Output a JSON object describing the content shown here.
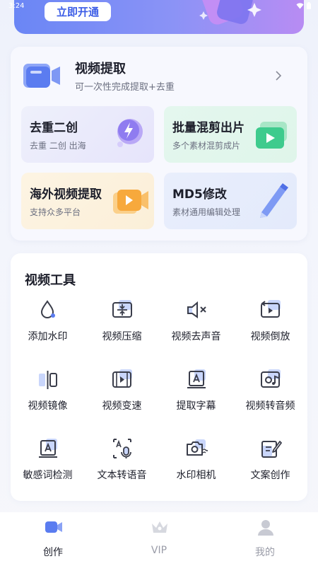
{
  "status": {
    "time": "3:24"
  },
  "banner": {
    "button_label": "立即开通"
  },
  "extract": {
    "title": "视频提取",
    "subtitle": "可一次性完成提取+去重"
  },
  "tiles": [
    {
      "title": "去重二创",
      "subtitle": "去重 二创 出海"
    },
    {
      "title": "批量混剪出片",
      "subtitle": "多个素材混剪成片"
    },
    {
      "title": "海外视频提取",
      "subtitle": "支持众多平台"
    },
    {
      "title": "MD5修改",
      "subtitle": "素材通用编辑处理"
    }
  ],
  "tools": {
    "title": "视频工具",
    "items": [
      {
        "label": "添加水印",
        "icon": "watermark-drop-icon"
      },
      {
        "label": "视频压缩",
        "icon": "compress-icon"
      },
      {
        "label": "视频去声音",
        "icon": "mute-icon"
      },
      {
        "label": "视频倒放",
        "icon": "reverse-icon"
      },
      {
        "label": "视频镜像",
        "icon": "mirror-icon"
      },
      {
        "label": "视频变速",
        "icon": "speed-icon"
      },
      {
        "label": "提取字幕",
        "icon": "subtitle-icon"
      },
      {
        "label": "视频转音频",
        "icon": "to-audio-icon"
      },
      {
        "label": "敏感词检测",
        "icon": "sensitive-word-icon"
      },
      {
        "label": "文本转语音",
        "icon": "text-to-speech-icon"
      },
      {
        "label": "水印相机",
        "icon": "watermark-camera-icon"
      },
      {
        "label": "文案创作",
        "icon": "copywriting-icon"
      }
    ]
  },
  "tabbar": {
    "items": [
      {
        "label": "创作",
        "icon": "create-icon",
        "active": true
      },
      {
        "label": "VIP",
        "icon": "crown-icon",
        "active": false
      },
      {
        "label": "我的",
        "icon": "profile-icon",
        "active": false
      }
    ]
  },
  "colors": {
    "accent": "#3b5ce6",
    "icon_blue": "#5a7cf0",
    "icon_light": "#c9d6fb",
    "tab_active": "#1d1f2b",
    "tab_inactive": "#9a9ca8"
  }
}
